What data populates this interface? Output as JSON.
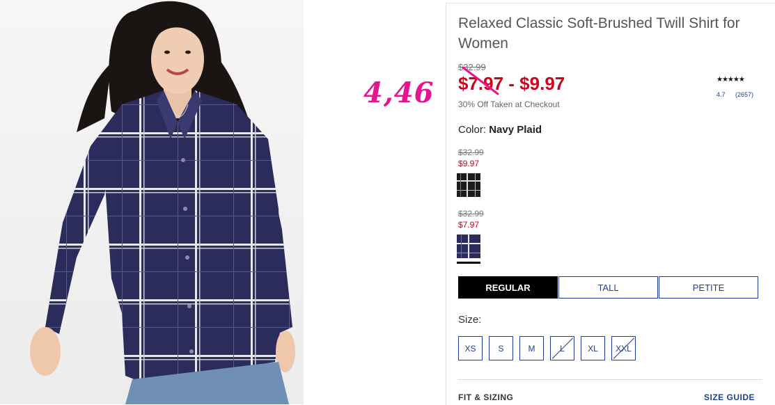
{
  "annotation": {
    "text": "4,46"
  },
  "product": {
    "title": "Relaxed Classic Soft-Brushed Twill Shirt for Women",
    "original_price": "$32.99",
    "sale_price": "$7.97 - $9.97",
    "promo": "30% Off Taken at Checkout",
    "rating": {
      "stars": "★★★★★",
      "value": "4.7",
      "count": "(2657)"
    },
    "color_label": "Color:",
    "color_value": "Navy Plaid",
    "swatches": [
      {
        "old_price": "$32.99",
        "new_price": "$9.97",
        "name": "black-white-plaid"
      },
      {
        "old_price": "$32.99",
        "new_price": "$7.97",
        "name": "navy-plaid",
        "selected": true
      }
    ],
    "fit_tabs": [
      "REGULAR",
      "TALL",
      "PETITE"
    ],
    "active_fit": "REGULAR",
    "size_label": "Size:",
    "sizes": [
      {
        "label": "XS",
        "available": true
      },
      {
        "label": "S",
        "available": true
      },
      {
        "label": "M",
        "available": true
      },
      {
        "label": "L",
        "available": false
      },
      {
        "label": "XL",
        "available": true
      },
      {
        "label": "XXL",
        "available": false
      }
    ],
    "fit_sizing_label": "FIT & SIZING",
    "size_guide_label": "SIZE GUIDE"
  },
  "colors": {
    "sale": "#d0021b",
    "link": "#1d3f91",
    "annotation": "#e6148f",
    "shirt": "#2b2b5c"
  }
}
